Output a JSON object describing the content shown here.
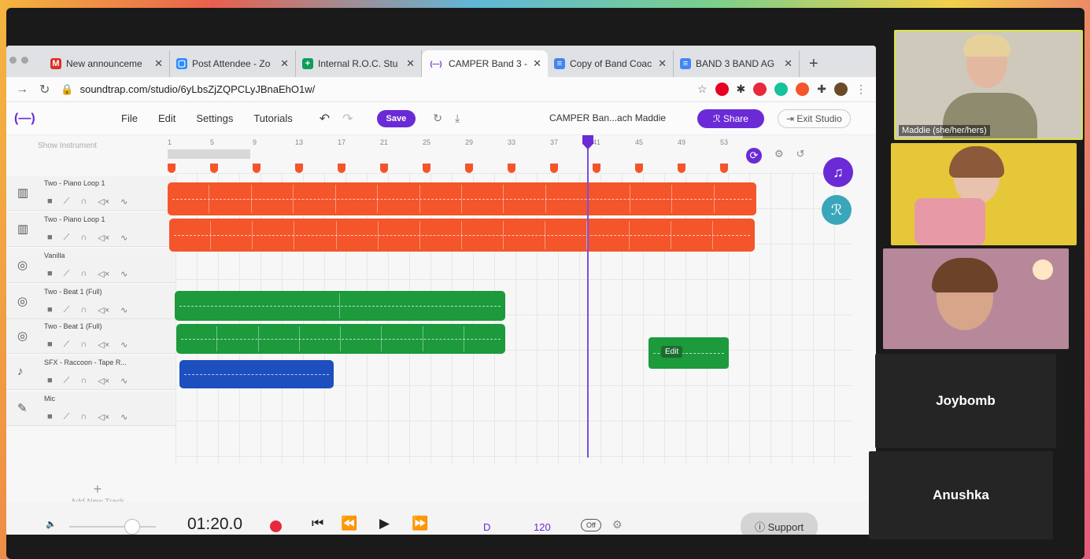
{
  "browser": {
    "tabs": [
      {
        "label": "New announceme",
        "icon": "gmail-icon",
        "color": "#d93025",
        "glyph": "M"
      },
      {
        "label": "Post Attendee - Zo",
        "icon": "zoom-icon",
        "color": "#2d8cff",
        "glyph": "▢"
      },
      {
        "label": "Internal R.O.C. Stu",
        "icon": "sheets-icon",
        "color": "#0f9d58",
        "glyph": "+"
      },
      {
        "label": "CAMPER Band 3 - (",
        "icon": "soundtrap-icon",
        "color": "#6a2bd6",
        "glyph": "(—)"
      },
      {
        "label": "Copy of Band Coac",
        "icon": "docs-icon",
        "color": "#4285f4",
        "glyph": "≡"
      },
      {
        "label": "BAND 3 BAND AG",
        "icon": "docs-icon",
        "color": "#4285f4",
        "glyph": "≡"
      }
    ],
    "url": "soundtrap.com/studio/6yLbsZjZQPCLyJBnaEhO1w/"
  },
  "toolbar": {
    "logo": "(—)",
    "menu": [
      "File",
      "Edit",
      "Settings",
      "Tutorials"
    ],
    "save_label": "Save",
    "project_title": "CAMPER Ban...ach Maddie",
    "share_label": "Share",
    "exit_label": "Exit Studio"
  },
  "studio": {
    "show_instrument": "Show Instrument",
    "ruler_ticks": [
      "1",
      "5",
      "9",
      "13",
      "17",
      "21",
      "25",
      "29",
      "33",
      "37",
      "41",
      "45",
      "49",
      "53"
    ],
    "tracks": [
      {
        "name": "Two - Piano Loop 1",
        "icon": "piano-icon"
      },
      {
        "name": "Two - Piano Loop 1",
        "icon": "piano-icon"
      },
      {
        "name": "Vanilla",
        "icon": "drum-icon"
      },
      {
        "name": "Two - Beat 1 (Full)",
        "icon": "drum-icon"
      },
      {
        "name": "Two - Beat 1 (Full)",
        "icon": "drum-icon"
      },
      {
        "name": "SFX - Raccoon - Tape R...",
        "icon": "speaker-icon"
      },
      {
        "name": "Mic",
        "icon": "mic-icon"
      }
    ],
    "add_track_label": "Add New Track",
    "edit_tooltip": "Edit"
  },
  "transport": {
    "time": "01:20.0",
    "key": "D",
    "tempo": "120",
    "metronome": "Off",
    "support_label": "Support"
  },
  "participants": [
    {
      "name": "Maddie (she/her/hers)"
    },
    {
      "name": ""
    },
    {
      "name": ""
    },
    {
      "name": "Joybomb"
    },
    {
      "name": "Anushka"
    }
  ],
  "colors": {
    "accent": "#6a2bd6",
    "piano_clip": "#f4552a",
    "beat_clip": "#1c9a3c",
    "sfx_clip": "#1d4fbf",
    "record": "#e8283c"
  }
}
